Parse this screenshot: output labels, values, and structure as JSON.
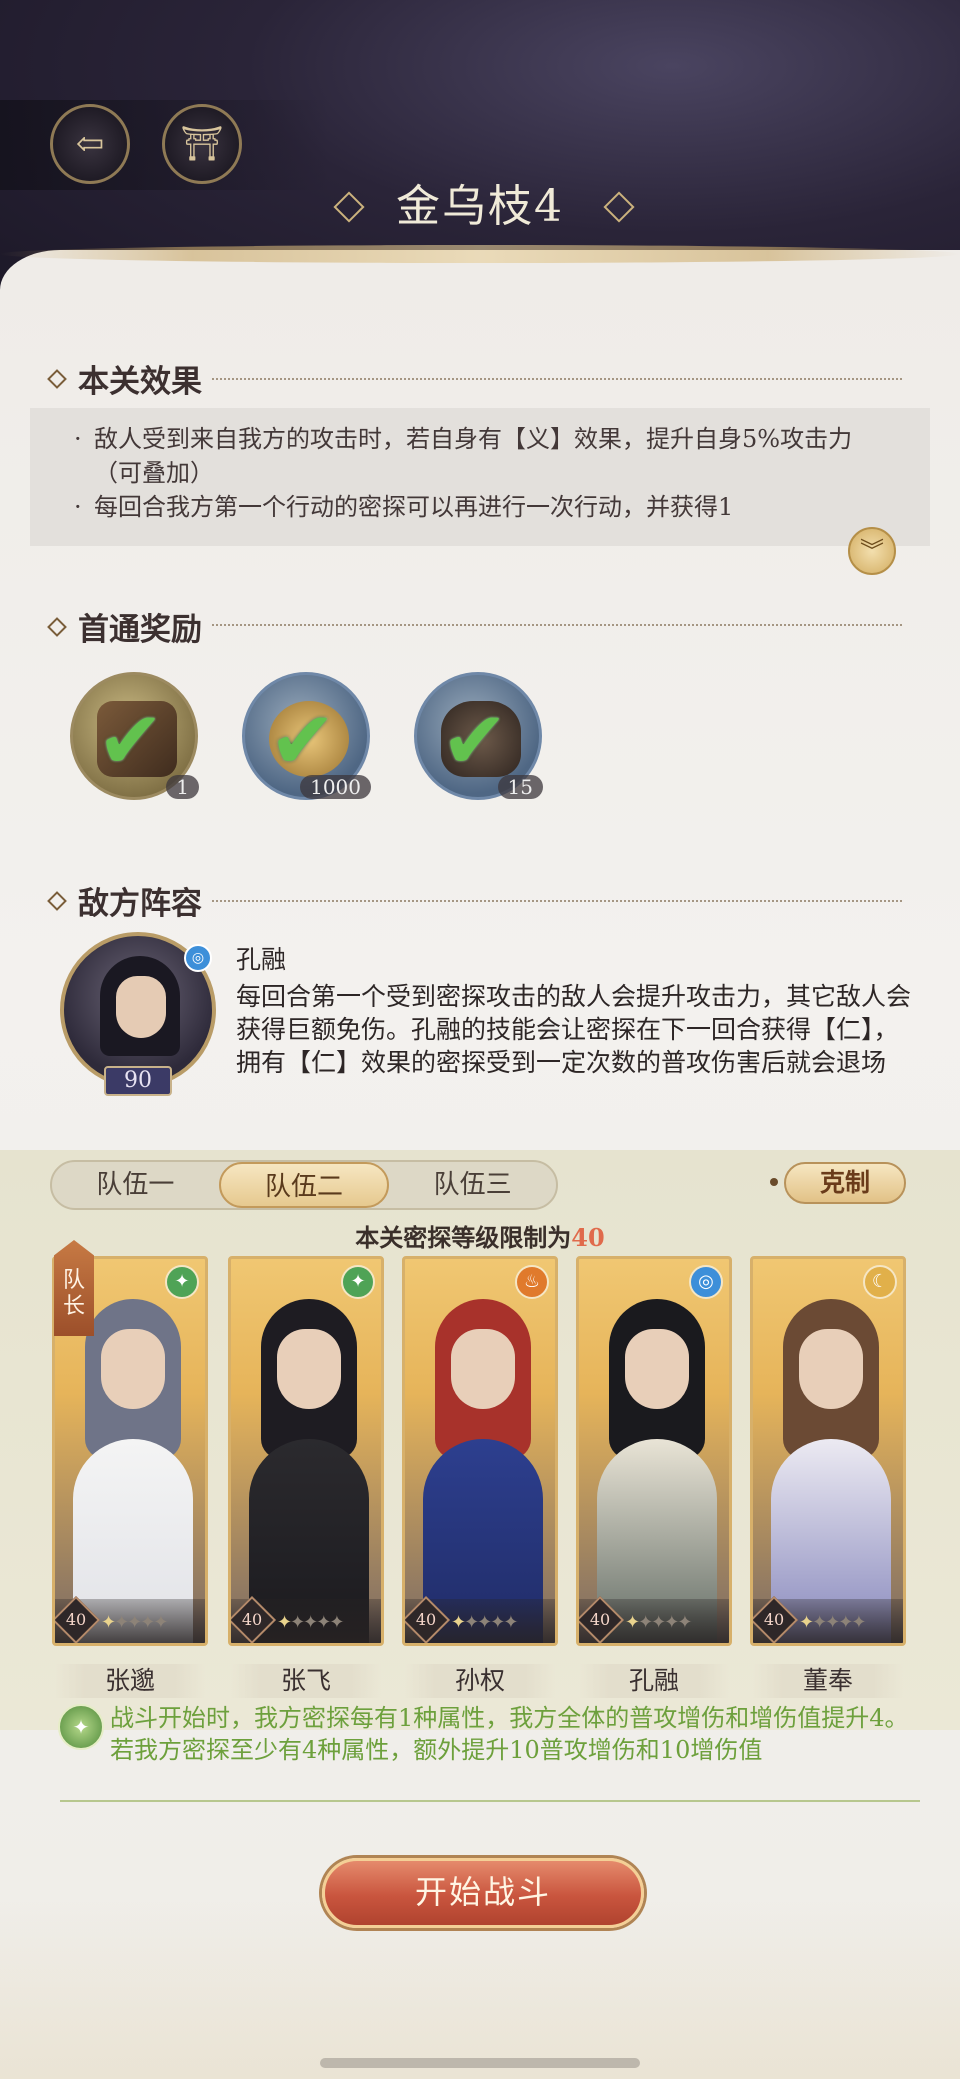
{
  "header": {
    "title": "金乌枝4",
    "back_icon": "back-arrow-icon",
    "home_icon": "pavilion-icon"
  },
  "stage_effect": {
    "heading": "本关效果",
    "items": [
      "敌人受到来自我方的攻击时，若自身有【义】效果，提升自身5%攻击力（可叠加）",
      "每回合我方第一个行动的密探可以再进行一次行动，并获得1"
    ],
    "expand_icon": "double-chevron-down-icon"
  },
  "first_clear_reward": {
    "heading": "首通奖励",
    "items": [
      {
        "name": "token-item",
        "count": "1",
        "claimed": true
      },
      {
        "name": "coin-item",
        "count": "1000",
        "claimed": true
      },
      {
        "name": "jar-item",
        "count": "15",
        "claimed": true
      }
    ]
  },
  "enemy": {
    "heading": "敌方阵容",
    "name": "孔融",
    "level": "90",
    "description": "每回合第一个受到密探攻击的敌人会提升攻击力，其它敌人会获得巨额免伤。孔融的技能会让密探在下一回合获得【仁】，拥有【仁】效果的密探受到一定次数的普攻伤害后就会退场"
  },
  "team": {
    "tabs": [
      "队伍一",
      "队伍二",
      "队伍三"
    ],
    "active_tab": 1,
    "restrain_label": "克制",
    "limit_prefix": "本关密探等级限制为",
    "limit_value": "40",
    "captain_label": "队长",
    "members": [
      {
        "name": "张邈",
        "level": "40",
        "element": "wind",
        "stars": 1
      },
      {
        "name": "张飞",
        "level": "40",
        "element": "wind",
        "stars": 1
      },
      {
        "name": "孙权",
        "level": "40",
        "element": "fire",
        "stars": 1
      },
      {
        "name": "孔融",
        "level": "40",
        "element": "water",
        "stars": 1
      },
      {
        "name": "董奉",
        "level": "40",
        "element": "moon",
        "stars": 1
      }
    ]
  },
  "bonus": {
    "text": "战斗开始时，我方密探每有1种属性，我方全体的普攻增伤和增伤值提升4。若我方密探至少有4种属性，额外提升10普攻增伤和10增伤值"
  },
  "start_button": "开始战斗",
  "colors": {
    "accent_gold": "#d7b06a",
    "start_red": "#c9553e",
    "bonus_green": "#6da03c",
    "limit_red": "#e06a4b"
  }
}
